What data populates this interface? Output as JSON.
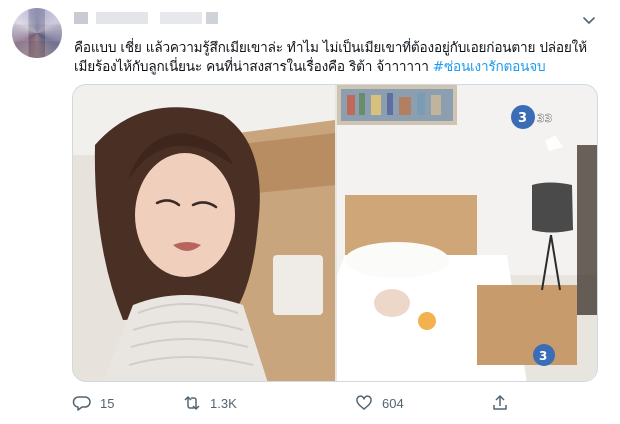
{
  "tweet": {
    "text_line1": "คือแบบ  เชี่ย  แล้วความรู้สึกเมียเขาล่ะ  ทำไม  ไม่เป็นเมียเขาที่ต้องอยู่กับเอยก่อนตาย  ปล่อยให้",
    "text_line2": "เมียร้องไห้กับลูกเนี่ยนะ  คนที่น่าสงสารในเรื่องคือ  ริต้า  จ้าาาาาา  ",
    "hashtag": "#ซ่อนเงารักตอนจบ"
  },
  "media": {
    "left_alt": "crying woman",
    "right_alt": "baby on bed",
    "channel_logo": "3 HD 33",
    "channel_logo_small": "3 SOOH"
  },
  "actions": {
    "reply_count": "15",
    "retweet_count": "1.3K",
    "like_count": "604"
  },
  "icons": {
    "reply": "reply-icon",
    "retweet": "retweet-icon",
    "like": "heart-icon",
    "share": "share-icon",
    "more": "chevron-down-icon"
  },
  "colors": {
    "hashtag": "#1d9bf0",
    "action_gray": "#536471"
  }
}
